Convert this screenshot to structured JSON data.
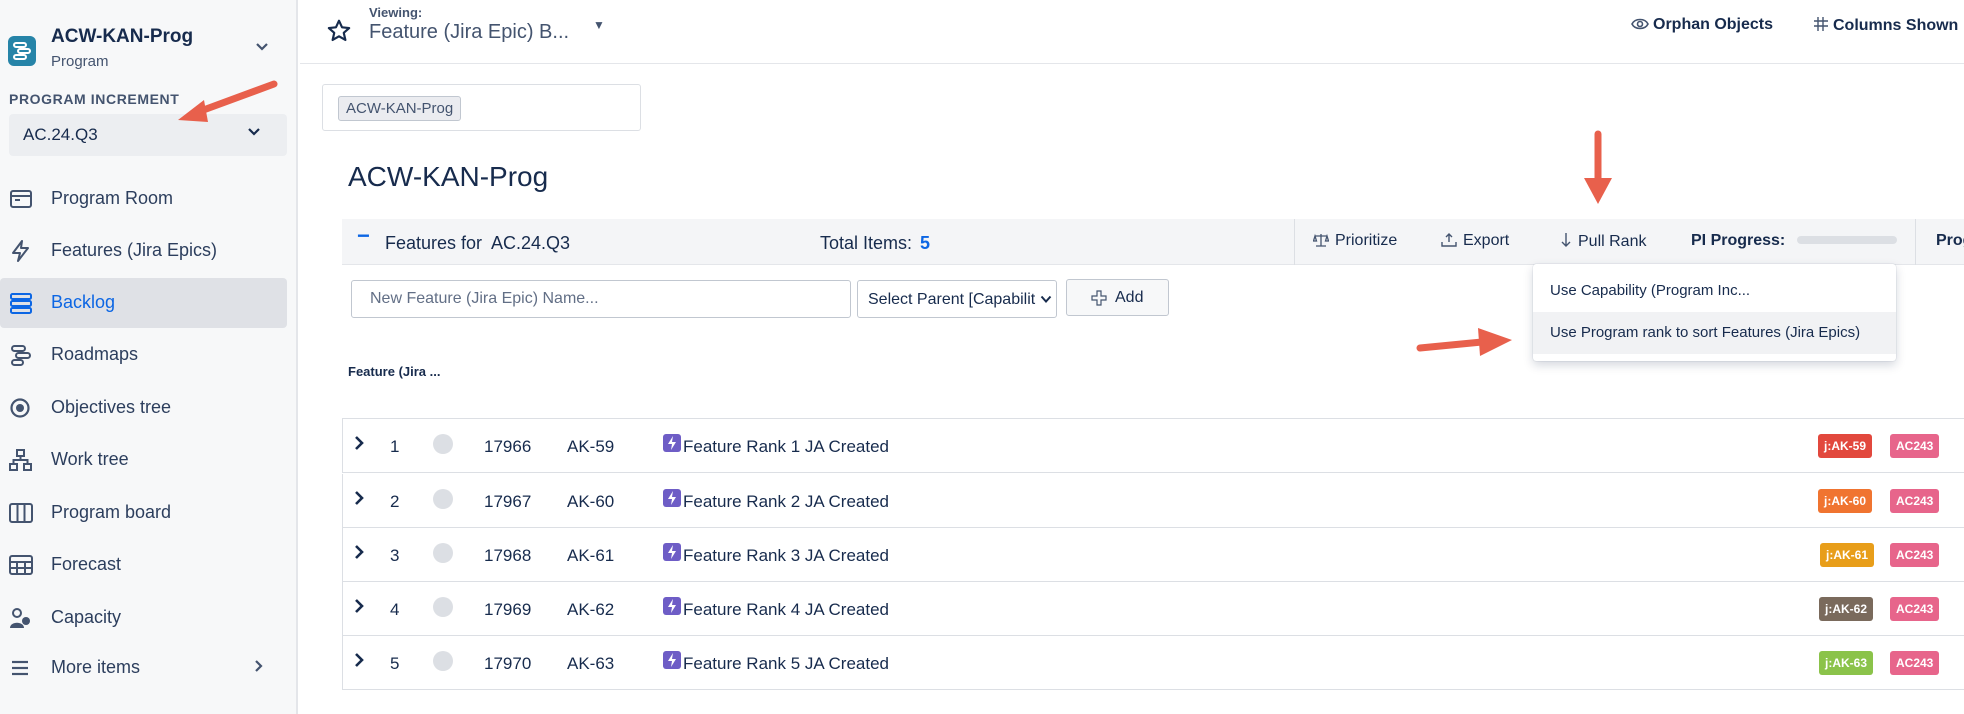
{
  "sidebar": {
    "project_name": "ACW-KAN-Prog",
    "project_type": "Program",
    "pi_label": "PROGRAM INCREMENT",
    "pi_value": "AC.24.Q3",
    "items": [
      {
        "label": "Program Room",
        "icon": "program-room-icon"
      },
      {
        "label": "Features (Jira Epics)",
        "icon": "lightning-icon"
      },
      {
        "label": "Backlog",
        "icon": "backlog-icon",
        "active": true
      },
      {
        "label": "Roadmaps",
        "icon": "roadmap-icon"
      },
      {
        "label": "Objectives tree",
        "icon": "target-icon"
      },
      {
        "label": "Work tree",
        "icon": "hierarchy-icon"
      },
      {
        "label": "Program board",
        "icon": "board-icon"
      },
      {
        "label": "Forecast",
        "icon": "grid-icon"
      },
      {
        "label": "Capacity",
        "icon": "people-icon"
      },
      {
        "label": "More items",
        "icon": "menu-icon"
      }
    ]
  },
  "header": {
    "viewing_label": "Viewing:",
    "viewing_value": "Feature (Jira Epic) B...",
    "orphan_objects": "Orphan Objects",
    "columns_shown": "Columns Shown"
  },
  "main": {
    "tag_chip": "ACW-KAN-Prog",
    "page_title": "ACW-KAN-Prog",
    "features_for": "Features for",
    "features_pi": "AC.24.Q3",
    "total_label": "Total Items:",
    "total_count": "5",
    "toolbar": {
      "prioritize": "Prioritize",
      "export": "Export",
      "pull_rank": "Pull Rank",
      "pi_progress": "PI Progress:",
      "prog_truncated": "Prog"
    },
    "new_feature_placeholder": "New Feature (Jira Epic) Name...",
    "parent_select": "Select Parent [Capabilit",
    "add_label": "Add",
    "column_header": "Feature (Jira ...",
    "rows": [
      {
        "rank": "1",
        "id": "17966",
        "key": "AK-59",
        "name": "Feature Rank 1 JA Created",
        "badge": "j:AK-59",
        "badge_color": "#e2483d",
        "pi_badge": "AC243"
      },
      {
        "rank": "2",
        "id": "17967",
        "key": "AK-60",
        "name": "Feature Rank 2 JA Created",
        "badge": "j:AK-60",
        "badge_color": "#f07430",
        "pi_badge": "AC243"
      },
      {
        "rank": "3",
        "id": "17968",
        "key": "AK-61",
        "name": "Feature Rank 3 JA Created",
        "badge": "j:AK-61",
        "badge_color": "#e89e1a",
        "pi_badge": "AC243"
      },
      {
        "rank": "4",
        "id": "17969",
        "key": "AK-62",
        "name": "Feature Rank 4 JA Created",
        "badge": "j:AK-62",
        "badge_color": "#7a6a5c",
        "pi_badge": "AC243"
      },
      {
        "rank": "5",
        "id": "17970",
        "key": "AK-63",
        "name": "Feature Rank 5 JA Created",
        "badge": "j:AK-63",
        "badge_color": "#8bc34a",
        "pi_badge": "AC243"
      }
    ]
  },
  "dropdown": {
    "items": [
      "Use Capability (Program Inc...",
      "Use Program rank to sort Features (Jira Epics)"
    ]
  },
  "colors": {
    "accent": "#0c66e4",
    "annotation_arrow": "#e8604c",
    "pi_badge": "#e7658b"
  }
}
